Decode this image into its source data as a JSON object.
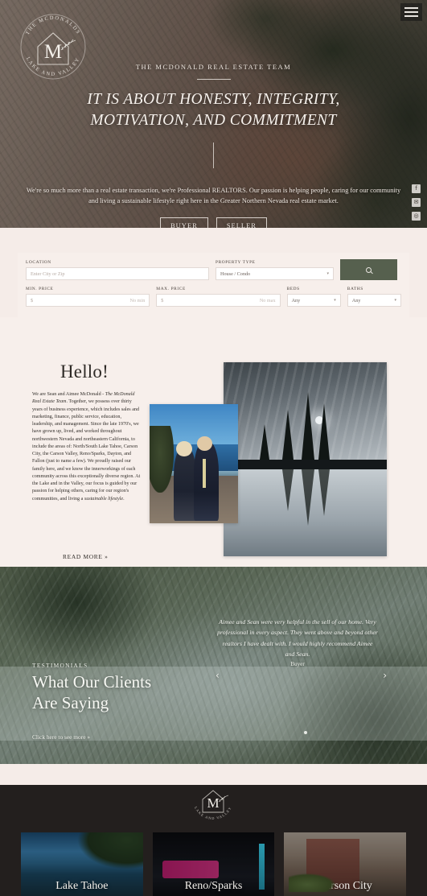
{
  "header": {
    "logo": {
      "top_arc": "THE MCDONALDS",
      "bottom_arc": "LAKE AND VALLEY",
      "monogram": "M"
    },
    "menu_icon": "hamburger-menu-icon"
  },
  "hero": {
    "eyebrow": "THE MCDONALD REAL ESTATE TEAM",
    "title_line1": "IT IS ABOUT HONESTY, INTEGRITY,",
    "title_line2": "MOTIVATION, AND COMMITMENT",
    "paragraph": "We're so much more than a real estate transaction, we're Professional REALTORS. Our passion is helping people, caring for our community and living a sustainable lifestyle right here in the Greater Northern Nevada real estate market.",
    "buttons": [
      {
        "label": "BUYER"
      },
      {
        "label": "SELLER"
      }
    ]
  },
  "social": [
    {
      "name": "facebook-icon",
      "glyph": "f"
    },
    {
      "name": "email-icon",
      "glyph": "✉"
    },
    {
      "name": "instagram-icon",
      "glyph": "◎"
    }
  ],
  "search": {
    "location": {
      "label": "LOCATION",
      "placeholder": "Enter City or Zip",
      "value": ""
    },
    "property_type": {
      "label": "PROPERTY TYPE",
      "value": "House / Condo"
    },
    "min_price": {
      "label": "MIN. PRICE",
      "prefix": "$",
      "placeholder": "No min",
      "value": ""
    },
    "max_price": {
      "label": "MAX. PRICE",
      "prefix": "$",
      "placeholder": "No max",
      "value": ""
    },
    "beds": {
      "label": "BEDS",
      "value": "Any"
    },
    "baths": {
      "label": "BATHS",
      "value": "Any"
    },
    "submit_icon": "search-icon",
    "accent_color": "#56604e"
  },
  "about": {
    "heading": "Hello!",
    "intro": "We are Sean and Aimee McDonald - ",
    "team_name": "The McDonald Real Estate Team",
    "body": ". Together, we possess over thirty years of business experience, which includes sales and marketing, finance, public service, education, leadership, and management.  Since the late 1970's, we have grown up, lived, and worked throughout northwestern Nevada and northeastern California, to include the areas of: North/South Lake Tahoe, Carson City, the Carson Valley, Reno/Sparks, Dayton, and Fallon (just to name a few).  We proudly raised our family here, and we know the innerworkings of each community across this exceptionally diverse region.  At the Lake and in the Valley, our focus is guided by our passion for helping others, caring for our region's communities, and living a ",
    "body_emphasis": "sustainable lifestyle",
    "body_end": ".",
    "read_more": "READ MORE »",
    "image_couple": "portrait-of-sean-and-aimee",
    "image_lake": "black-and-white-lake-reflection"
  },
  "testimonials": {
    "eyebrow": "TESTIMONIALS",
    "heading_line1": "What Our Clients",
    "heading_line2": "Are Saying",
    "link": "Click here to see more »",
    "quote": "Aimee and Sean were very helpful in the sell of our home. Very professional in every aspect. They went above and beyond other realtors I have dealt with. I would highly recommend Aimee and Sean.",
    "author": "Buyer",
    "prev_icon": "chevron-left-icon",
    "next_icon": "chevron-right-icon"
  },
  "footer": {
    "logo_monogram": "M",
    "logo_bottom_arc": "LAKE AND VALLEY",
    "cities": [
      {
        "name": "Lake Tahoe",
        "image": "lake-tahoe-photo"
      },
      {
        "name": "Reno/Sparks",
        "image": "reno-sparks-photo"
      },
      {
        "name": "Carson City",
        "image": "carson-city-photo"
      }
    ]
  }
}
